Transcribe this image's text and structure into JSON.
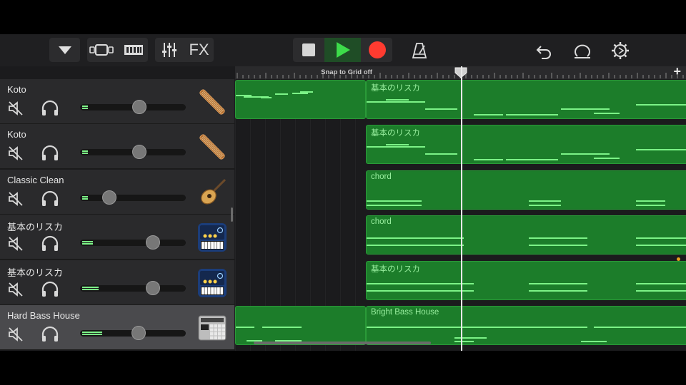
{
  "toolbar": {
    "fx_label": "FX",
    "icons": [
      "browser-dropdown-icon",
      "tracks-view-icon",
      "live-loops-grid-icon",
      "mixer-icon",
      "stop-icon",
      "play-icon",
      "record-icon",
      "metronome-icon",
      "undo-icon",
      "loop-icon",
      "settings-icon"
    ]
  },
  "ruler": {
    "snap_label": "Snap to Grid off",
    "add_label": "+"
  },
  "colors": {
    "region_fill": "#1c7d2a",
    "note": "#7cf387",
    "record": "#ff3b30",
    "play": "#3ddc4a"
  },
  "tracks": [
    {
      "name": "Koto",
      "instrument": "koto-icon",
      "volume": 0.57,
      "meter": 0.15,
      "selected": false
    },
    {
      "name": "Koto",
      "instrument": "koto-icon",
      "volume": 0.57,
      "meter": 0.15,
      "selected": false
    },
    {
      "name": "Classic Clean",
      "instrument": "guitar-icon",
      "volume": 0.24,
      "meter": 0.15,
      "selected": false
    },
    {
      "name": "基本のリスカ",
      "instrument": "synth-keyboard-icon",
      "volume": 0.72,
      "meter": 0.3,
      "selected": false
    },
    {
      "name": "基本のリスカ",
      "instrument": "synth-keyboard-icon",
      "volume": 0.72,
      "meter": 0.45,
      "selected": false
    },
    {
      "name": "Hard Bass House",
      "instrument": "drum-machine-icon",
      "volume": 0.56,
      "meter": 0.55,
      "selected": true
    }
  ],
  "regions": [
    {
      "lane": 0,
      "label": "",
      "start": 0,
      "end": 0.29
    },
    {
      "lane": 0,
      "label": "基本のリスカ",
      "start": 0.29,
      "end": 1.0
    },
    {
      "lane": 1,
      "label": "基本のリスカ",
      "start": 0.29,
      "end": 1.0
    },
    {
      "lane": 2,
      "label": "chord",
      "start": 0.29,
      "end": 1.0
    },
    {
      "lane": 3,
      "label": "chord",
      "start": 0.29,
      "end": 1.0
    },
    {
      "lane": 4,
      "label": "基本のリスカ",
      "start": 0.29,
      "end": 1.0
    },
    {
      "lane": 5,
      "label": "",
      "start": 0,
      "end": 0.29
    },
    {
      "lane": 5,
      "label": "Bright Bass House",
      "start": 0.29,
      "end": 1.0
    }
  ]
}
